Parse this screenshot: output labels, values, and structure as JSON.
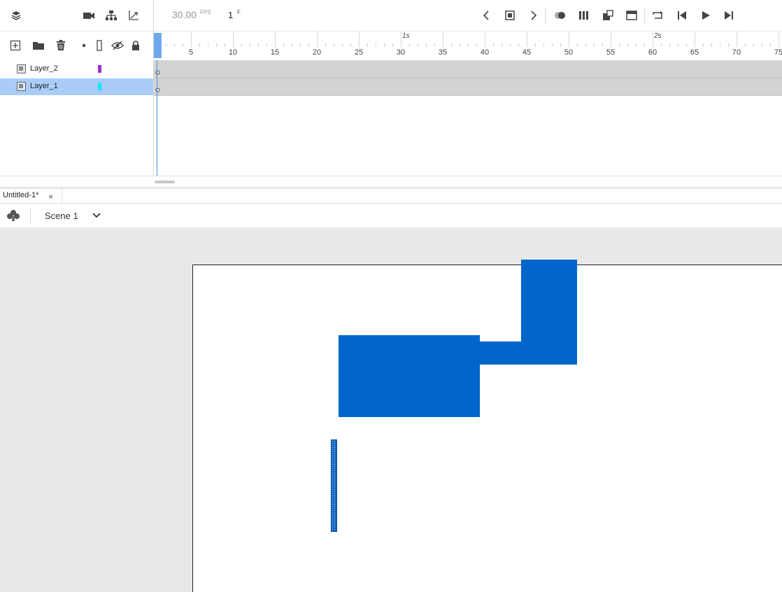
{
  "toolbar": {
    "fps_value": "30.00",
    "fps_unit": "FPS",
    "frame_value": "1",
    "frame_unit": "F"
  },
  "ruler": {
    "frame_labels": [
      "5",
      "10",
      "15",
      "20",
      "25",
      "30",
      "35",
      "40",
      "45",
      "50",
      "55",
      "60",
      "65",
      "70",
      "75"
    ],
    "second_labels": [
      "1s",
      "2s"
    ]
  },
  "layers": [
    {
      "name": "Layer_2",
      "color": "#9b30c8",
      "selected": false
    },
    {
      "name": "Layer_1",
      "color": "#18e6f5",
      "selected": true
    }
  ],
  "document": {
    "tab_title": "Untitled-1*",
    "close_glyph": "×"
  },
  "scene": {
    "name": "Scene 1"
  },
  "colors": {
    "accent": "#4a90e2",
    "shape_fill": "#0066cc",
    "selected_row": "#a9cdf7",
    "frames_bg": "#d3d3d3",
    "pasteboard": "#e8e8e8"
  }
}
